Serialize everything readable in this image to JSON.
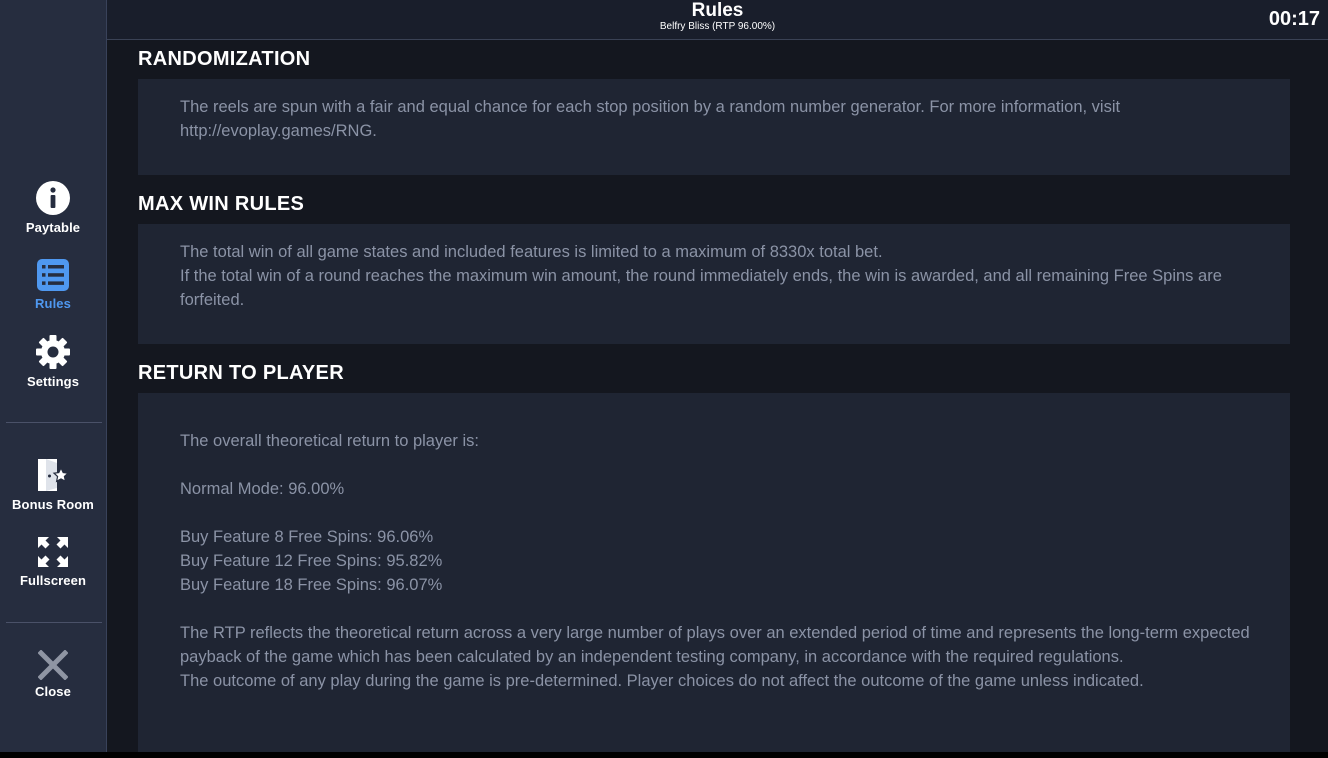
{
  "header": {
    "title": "Rules",
    "subtitle": "Belfry Bliss (RTP 96.00%)",
    "clock": "00:17"
  },
  "sidebar": {
    "items": [
      {
        "label": "Paytable",
        "icon": "info-icon"
      },
      {
        "label": "Rules",
        "icon": "list-icon",
        "active": true
      },
      {
        "label": "Settings",
        "icon": "gear-icon"
      },
      {
        "label": "Bonus Room",
        "icon": "bonus-room-door-star-icon"
      },
      {
        "label": "Fullscreen",
        "icon": "fullscreen-icon"
      },
      {
        "label": "Close",
        "icon": "close-icon"
      }
    ],
    "active_color": "#4f98f0"
  },
  "sections": {
    "randomization": {
      "heading": "RANDOMIZATION",
      "text": "The reels are spun with a fair and equal chance for each stop position by a random number generator. For more information, visit http://evoplay.games/RNG."
    },
    "max_win": {
      "heading": "MAX WIN RULES",
      "line1": "The total win of all game states and included features is limited to a maximum of 8330x total bet.",
      "line2": "If the total win of a round reaches the maximum win amount, the round immediately ends, the win is awarded, and all remaining Free Spins are forfeited."
    },
    "rtp": {
      "heading": "RETURN TO PLAYER",
      "intro": "The overall theoretical return to player is:",
      "normal": "Normal Mode: 96.00%",
      "buy8": "Buy Feature 8 Free Spins: 96.06%",
      "buy12": "Buy Feature 12 Free Spins: 95.82%",
      "buy18": "Buy Feature 18 Free Spins: 96.07%",
      "para1": "The RTP reflects the theoretical return across a very large number of plays over an extended period of time and represents the long-term expected payback of the game which has been calculated by an independent testing company, in accordance with the required regulations.",
      "para2": "The outcome of any play during the game is pre-determined. Player choices do not affect the outcome of the game unless indicated."
    }
  }
}
